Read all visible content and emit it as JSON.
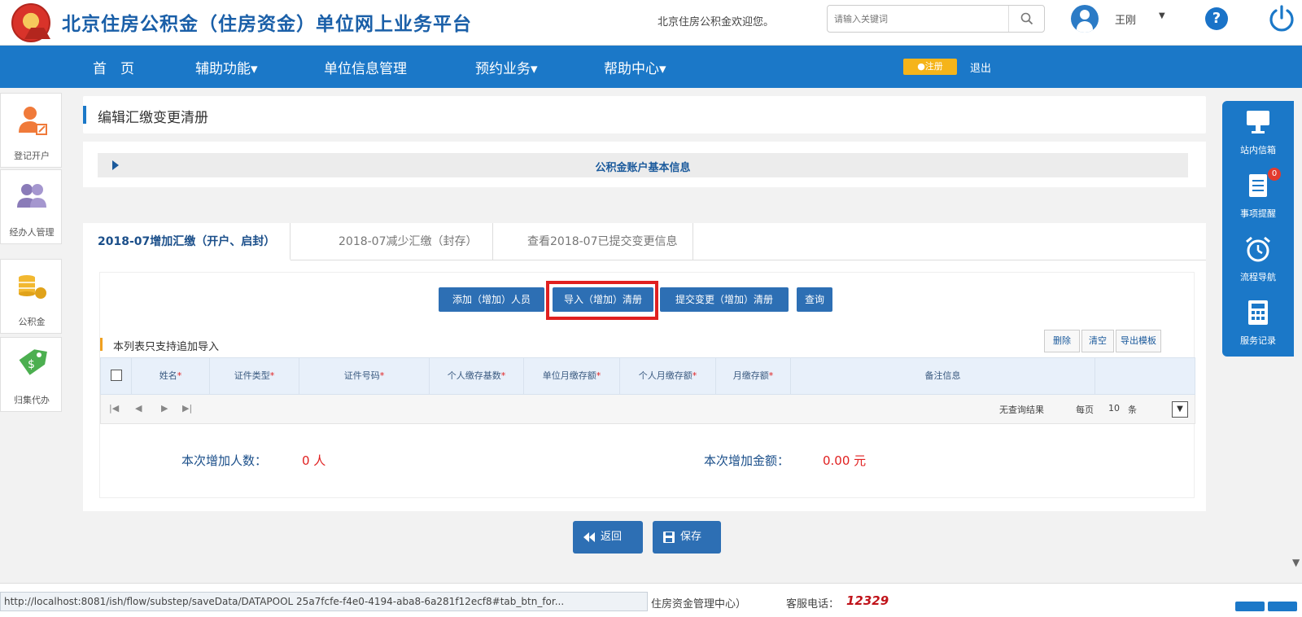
{
  "header": {
    "site_title": "北京住房公积金（住房资金）单位网上业务平台",
    "welcome": "北京住房公积金欢迎您。",
    "search_placeholder": "请输入关键词",
    "user_name": "王刚",
    "help_label": "?"
  },
  "nav": {
    "items": [
      "首　页",
      "辅助功能▾",
      "单位信息管理",
      "预约业务▾",
      "帮助中心▾"
    ],
    "badge": "●注册",
    "logout": "退出"
  },
  "sidebar": {
    "items": [
      {
        "label": "登记开户",
        "icon": "register-icon"
      },
      {
        "label": "经办人管理",
        "icon": "people-icon"
      },
      {
        "label": "公积金",
        "icon": "coins-icon"
      },
      {
        "label": "归集代办",
        "icon": "tag-icon"
      }
    ]
  },
  "rightbar": {
    "items": [
      {
        "label": "站内信箱",
        "icon": "monitor-icon"
      },
      {
        "label": "事项提醒",
        "icon": "document-icon",
        "badge": "0"
      },
      {
        "label": "流程导航",
        "icon": "alarm-clock-icon"
      },
      {
        "label": "服务记录",
        "icon": "calculator-icon"
      }
    ]
  },
  "page": {
    "title": "编辑汇缴变更清册",
    "info_panel_title": "公积金账户基本信息"
  },
  "tabs": [
    {
      "label": "2018-07增加汇缴（开户、启封）",
      "active": true
    },
    {
      "label": "2018-07减少汇缴（封存）",
      "active": false
    },
    {
      "label": "查看2018-07已提交变更信息",
      "active": false
    }
  ],
  "actions": {
    "add": "添加（增加）人员",
    "import": "导入（增加）清册",
    "submit": "提交变更（增加）清册",
    "query": "查询"
  },
  "list": {
    "note": "本列表只支持追加导入",
    "delete": "删除",
    "clear": "清空",
    "export_template": "导出模板",
    "columns": [
      {
        "label": "姓名",
        "required": true
      },
      {
        "label": "证件类型",
        "required": true
      },
      {
        "label": "证件号码",
        "required": true
      },
      {
        "label": "个人缴存基数",
        "required": true
      },
      {
        "label": "单位月缴存额",
        "required": true
      },
      {
        "label": "个人月缴存额",
        "required": true
      },
      {
        "label": "月缴存额",
        "required": true
      },
      {
        "label": "备注信息",
        "required": false
      }
    ],
    "required_mark": "*",
    "pager": {
      "first": "|◀",
      "prev": "◀",
      "next": "▶",
      "last": "▶|",
      "no_result": "无查询结果",
      "per_page_prefix": "每页",
      "per_page_value": "10",
      "per_page_suffix": "条",
      "select_glyph": "▼"
    }
  },
  "summary": {
    "count_label": "本次增加人数：",
    "count_value": "0 人",
    "amount_label": "本次增加金额：",
    "amount_value": "0.00 元"
  },
  "bottom_buttons": {
    "back": "返回",
    "save": "保存"
  },
  "footer": {
    "status_url": "http://localhost:8081/ish/flow/substep/saveData/DATAPOOL 25a7fcfe-f4e0-4194-aba8-6a281f12ecf8#tab_btn_for...",
    "org": "住房资金管理中心）",
    "phone_label": "客服电话：",
    "phone": "12329"
  },
  "colors": {
    "brand_blue": "#1b78c8",
    "button_blue": "#2d6fb4",
    "highlight_red": "#e02020",
    "badge_yellow": "#f5b41a"
  }
}
